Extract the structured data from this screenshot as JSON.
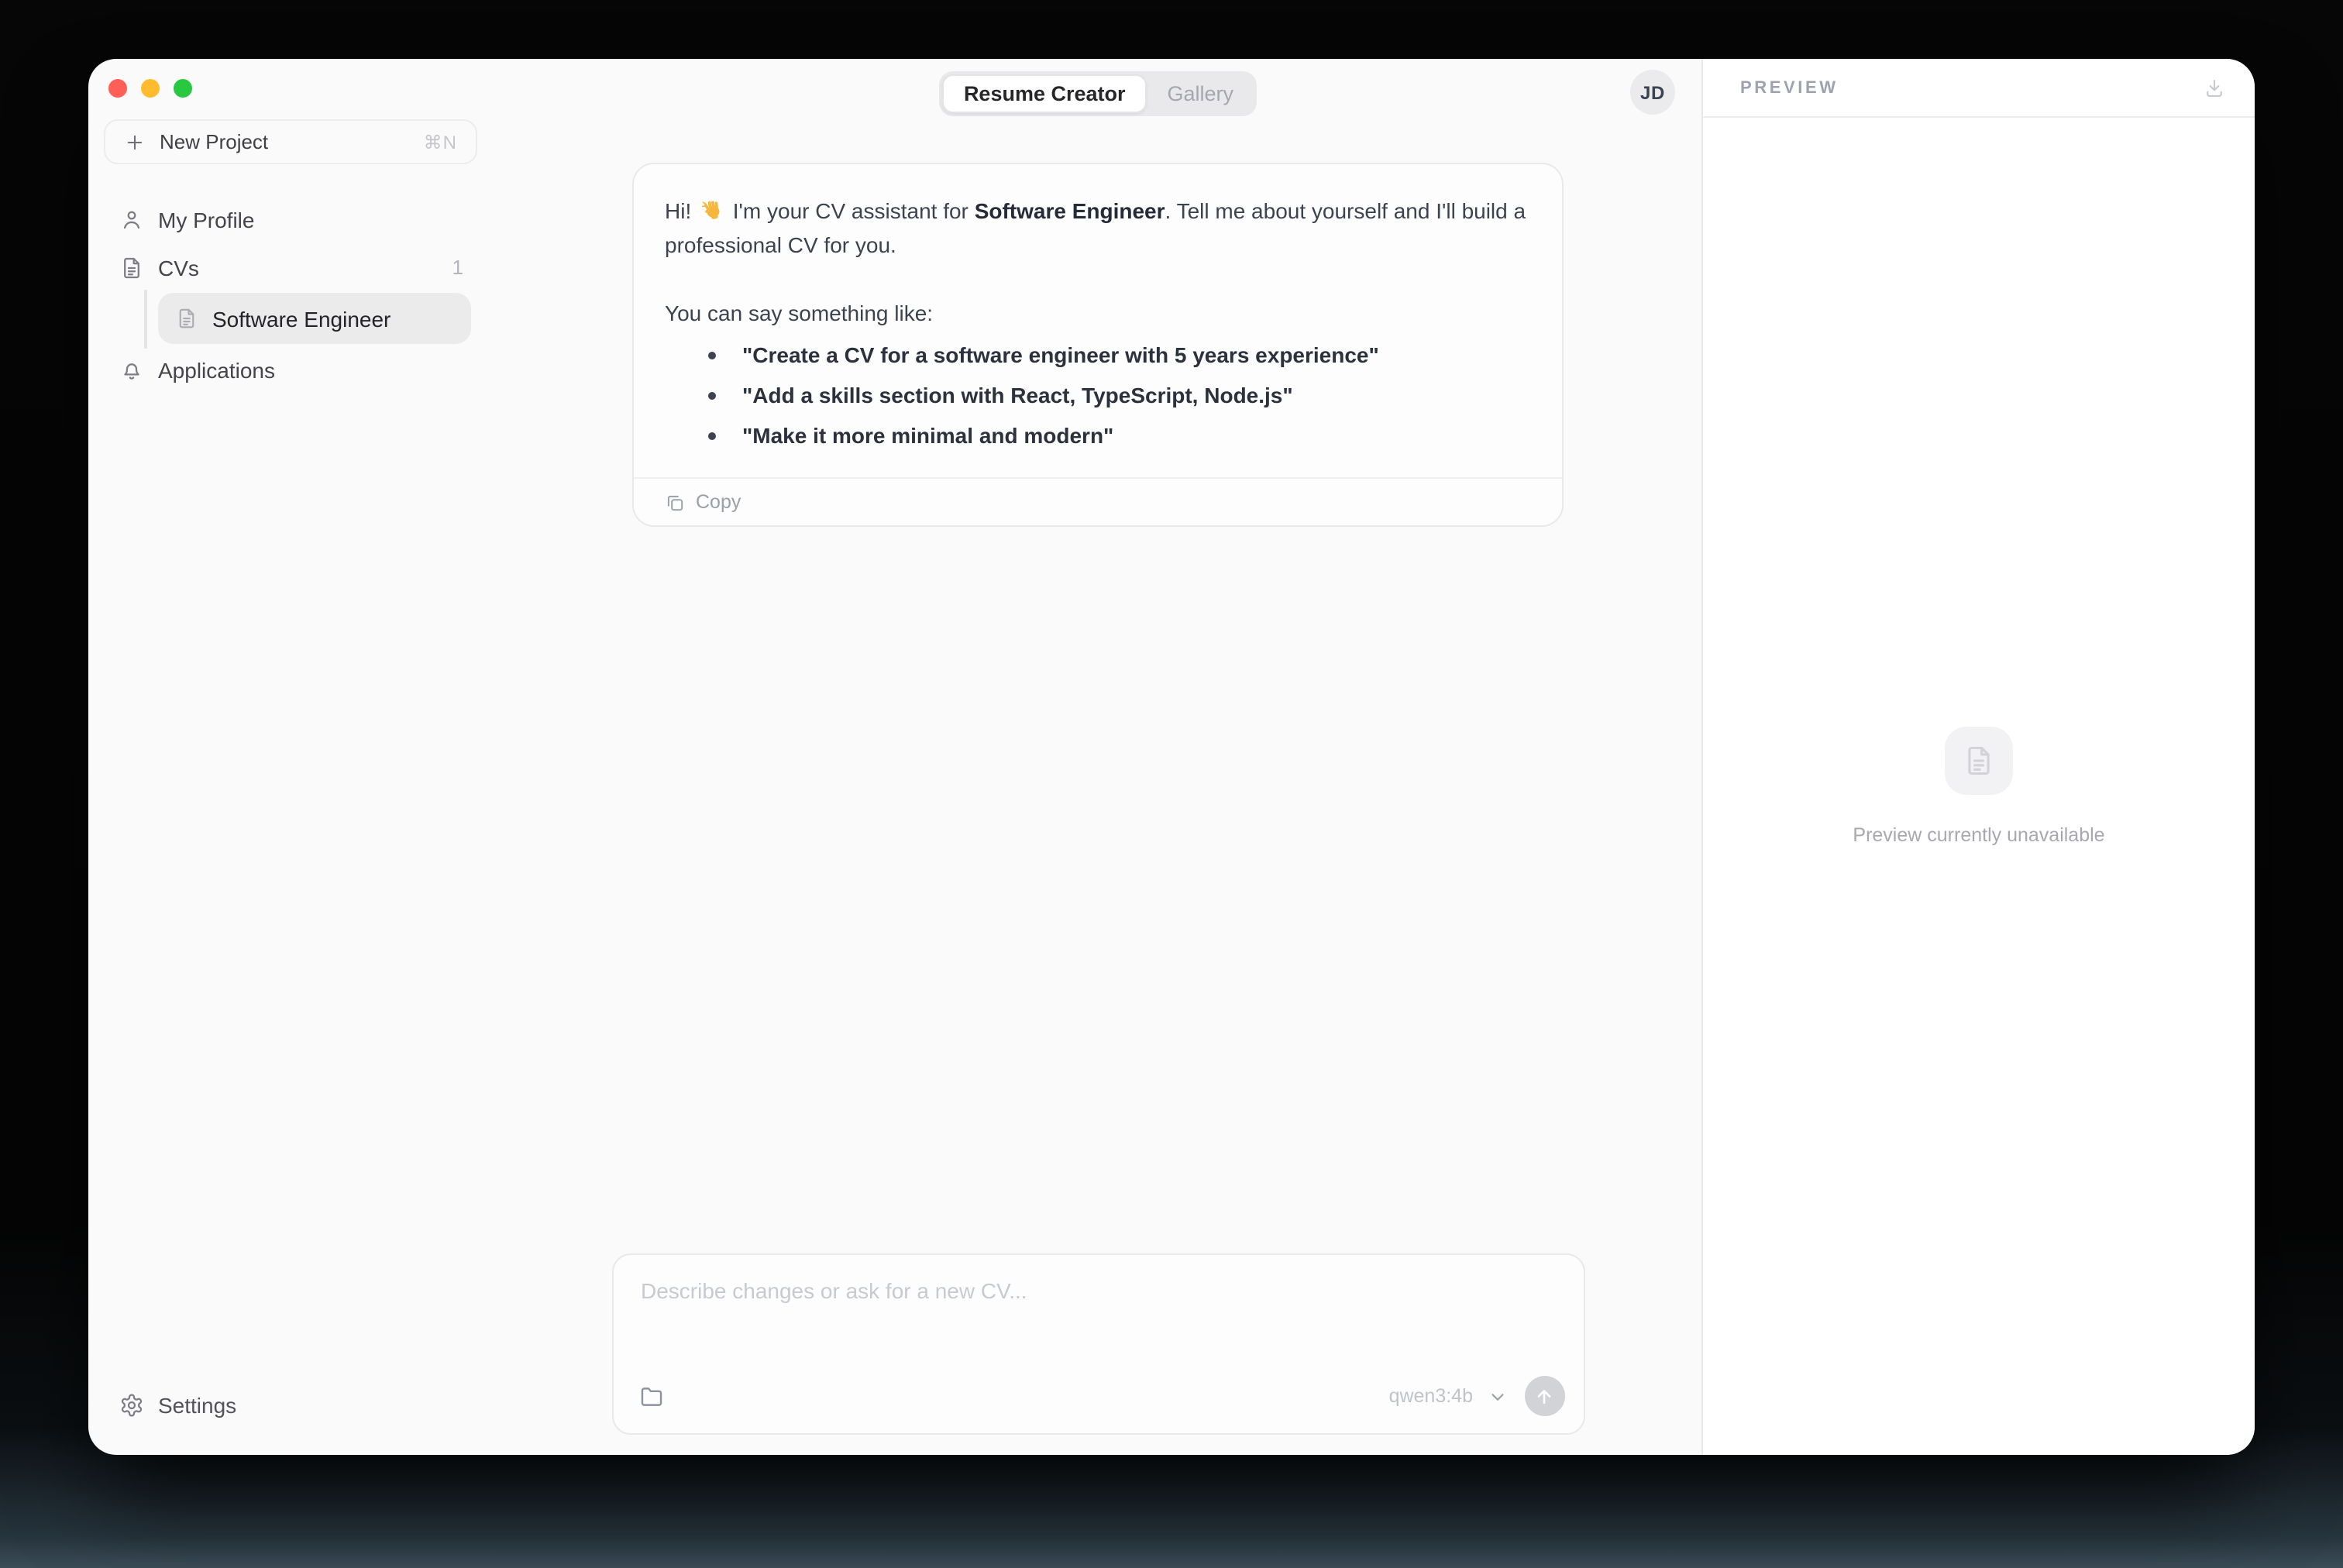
{
  "header": {
    "tabs": [
      {
        "label": "Resume Creator"
      },
      {
        "label": "Gallery"
      }
    ],
    "avatar_initials": "JD"
  },
  "sidebar": {
    "new_project_label": "New Project",
    "new_project_shortcut": "⌘N",
    "items": [
      {
        "label": "My Profile"
      },
      {
        "label": "CVs",
        "count": "1"
      },
      {
        "label": "Software Engineer"
      },
      {
        "label": "Applications"
      }
    ],
    "settings_label": "Settings"
  },
  "chat": {
    "message": {
      "greeting_pre": "Hi! ",
      "greeting_emoji": "👋",
      "greeting_mid": " I'm your CV assistant for ",
      "greeting_bold": "Software Engineer",
      "greeting_post": ". Tell me about yourself and I'll build a professional CV for you.",
      "suggestion_intro": "You can say something like:",
      "suggestions": [
        "\"Create a CV for a software engineer with 5 years experience\"",
        "\"Add a skills section with React, TypeScript, Node.js\"",
        "\"Make it more minimal and modern\""
      ],
      "copy_label": "Copy"
    },
    "composer": {
      "placeholder": "Describe changes or ask for a new CV...",
      "model_label": "qwen3:4b"
    }
  },
  "preview": {
    "title": "PREVIEW",
    "empty_message": "Preview currently unavailable"
  },
  "colors": {
    "traffic_close": "#ff5f57",
    "traffic_minimize": "#febc2e",
    "traffic_zoom": "#28c840",
    "wave_emoji": "#f6b73c",
    "window_bg": "#fafafa",
    "panel_bg": "#ffffff"
  }
}
